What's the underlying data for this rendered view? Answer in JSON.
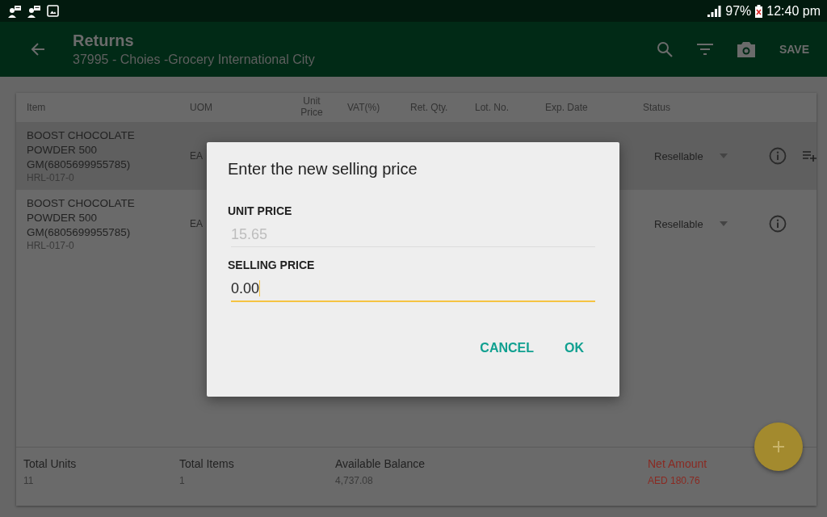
{
  "status_bar": {
    "battery": "97%",
    "time": "12:40 pm"
  },
  "app_bar": {
    "title": "Returns",
    "subtitle": "37995 -  Choies  -Grocery International City",
    "action": "SAVE"
  },
  "table": {
    "columns": [
      "Item",
      "UOM",
      "Unit Price",
      "VAT(%)",
      "Ret. Qty.",
      "Lot. No.",
      "Exp. Date",
      "Status"
    ],
    "rows": [
      {
        "item": "BOOST CHOCOLATE POWDER 500 GM(6805699955785)",
        "code": "HRL-017-0",
        "uom": "EA",
        "status": "Resellable",
        "selected": true,
        "addable": true
      },
      {
        "item": "BOOST CHOCOLATE POWDER 500 GM(6805699955785)",
        "code": "HRL-017-0",
        "uom": "EA",
        "status": "Resellable",
        "selected": false,
        "addable": false
      }
    ]
  },
  "totals": [
    {
      "label": "Total Units",
      "value": "11",
      "highlight": false
    },
    {
      "label": "Total Items",
      "value": "1",
      "highlight": false
    },
    {
      "label": "Available Balance",
      "value": "4,737.08",
      "highlight": false
    },
    {
      "label": "Net Amount",
      "value": "AED 180.76",
      "highlight": true
    }
  ],
  "dialog": {
    "title": "Enter the new selling price",
    "fields": [
      {
        "label": "UNIT PRICE",
        "value": "15.65",
        "disabled": true
      },
      {
        "label": "SELLING PRICE",
        "value": "0.00",
        "disabled": false
      }
    ],
    "buttons": [
      "CANCEL",
      "OK"
    ]
  }
}
